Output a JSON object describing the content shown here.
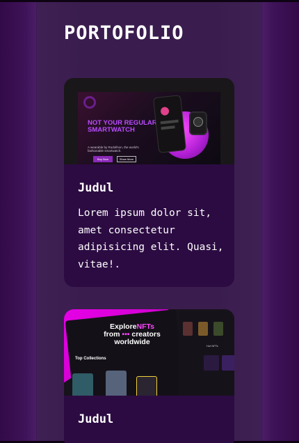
{
  "page": {
    "title": "PORTOFOLIO"
  },
  "cards": [
    {
      "heading": "Judul",
      "text": "Lorem ipsum dolor sit, amet consectetur adipisicing elit. Quasi, vitae!.",
      "image": {
        "headline": "NOT YOUR REGULAR SMARTWATCH",
        "sub": "A wearable by Rudolfson, the world's fashionable smartwatch.",
        "btn1": "Buy Now",
        "btn2": "Show More"
      }
    },
    {
      "heading": "Judul",
      "image": {
        "headline_a": "Explore",
        "headline_b": "NFTs",
        "headline_c": "from",
        "headline_d": "creators",
        "headline_e": "worldwide",
        "section": "Top Collections",
        "right_label": "Hot NFTs"
      }
    }
  ],
  "colors": {
    "background": "#3a1d4e",
    "card": "#2c0b42",
    "accent_purple": "#b94cff",
    "accent_pink": "#e600e6"
  }
}
